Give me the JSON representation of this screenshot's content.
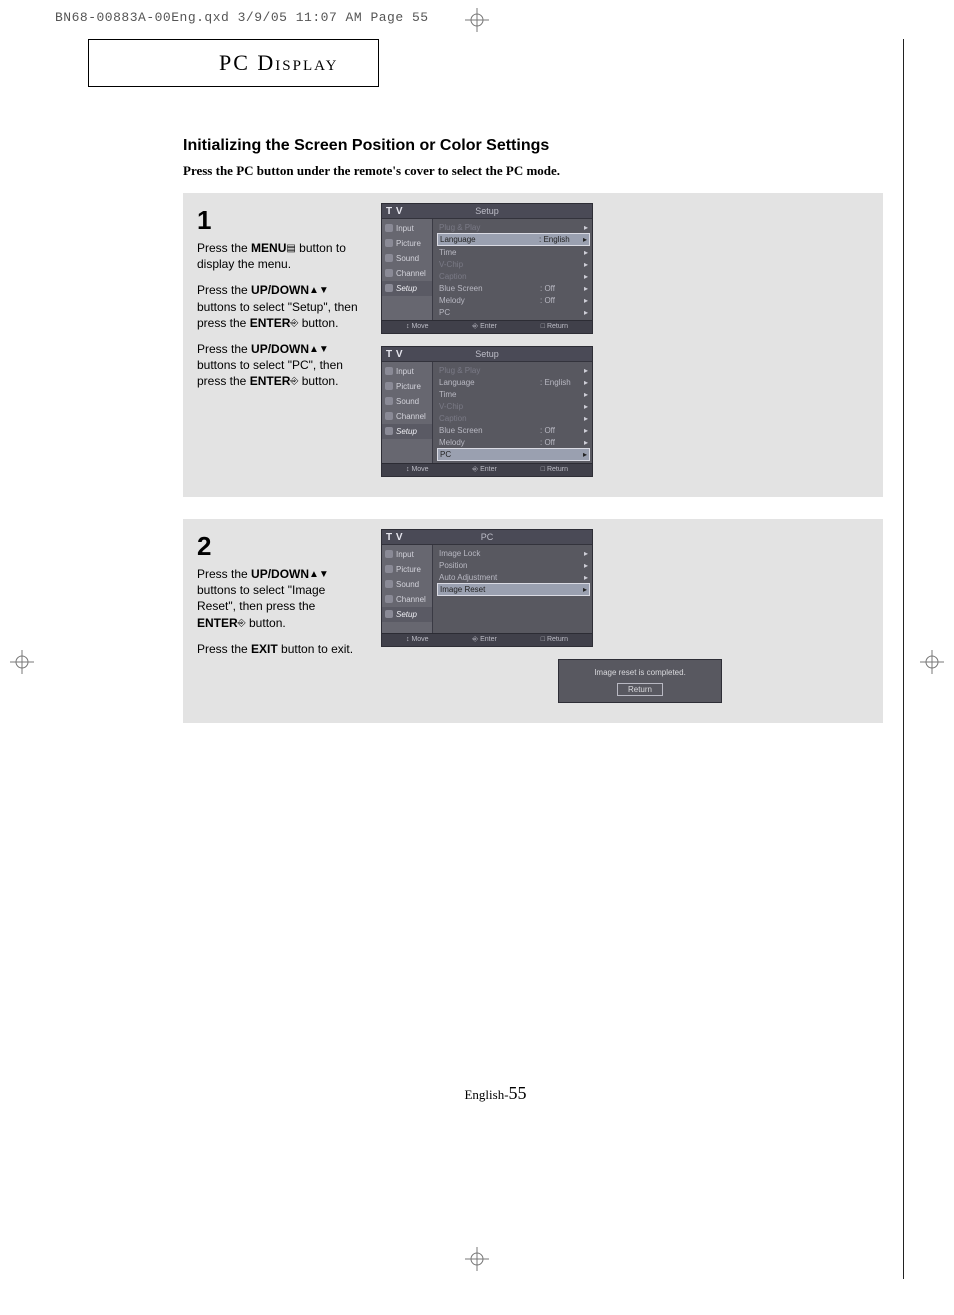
{
  "print_header": "BN68-00883A-00Eng.qxd  3/9/05 11:07 AM  Page 55",
  "page_title_box": "PC Display",
  "heading": "Initializing the Screen Position or Color Settings",
  "intro": "Press the PC button under the remote's cover to select the PC mode.",
  "step1": {
    "num": "1",
    "p1a": "Press the ",
    "p1b": "MENU",
    "p1c": " button to display the menu.",
    "p2a": "Press the ",
    "p2b": "UP/DOWN",
    "p2c": " buttons to select \"Setup\", then press the ",
    "p2d": "ENTER",
    "p2e": " button.",
    "p3a": "Press the ",
    "p3b": "UP/DOWN",
    "p3c": " buttons to select \"PC\", then press the ",
    "p3d": "ENTER",
    "p3e": " button."
  },
  "step2": {
    "num": "2",
    "p1a": "Press the ",
    "p1b": "UP/DOWN",
    "p1c": " buttons to select \"Image Reset\", then press the ",
    "p1d": "ENTER",
    "p1e": " button.",
    "p2a": "Press the ",
    "p2b": "EXIT",
    "p2c": " button to exit."
  },
  "osd": {
    "tv": "T V",
    "title_setup": "Setup",
    "title_pc": "PC",
    "side": [
      "Input",
      "Picture",
      "Sound",
      "Channel",
      "Setup"
    ],
    "setup_rows": [
      {
        "label": "Plug & Play",
        "value": "",
        "dim": true
      },
      {
        "label": "Language",
        "value": ": English"
      },
      {
        "label": "Time",
        "value": ""
      },
      {
        "label": "V-Chip",
        "value": "",
        "dim": true
      },
      {
        "label": "Caption",
        "value": "",
        "dim": true
      },
      {
        "label": "Blue Screen",
        "value": ": Off"
      },
      {
        "label": "Melody",
        "value": ": Off"
      },
      {
        "label": "PC",
        "value": ""
      }
    ],
    "pc_rows": [
      {
        "label": "Image Lock",
        "value": ""
      },
      {
        "label": "Position",
        "value": ""
      },
      {
        "label": "Auto Adjustment",
        "value": ""
      },
      {
        "label": "Image Reset",
        "value": ""
      }
    ],
    "footer_move": "Move",
    "footer_enter": "Enter",
    "footer_return": "Return",
    "dialog_msg": "Image reset is completed.",
    "dialog_btn": "Return"
  },
  "footer_prefix": "English-",
  "footer_num": "55"
}
